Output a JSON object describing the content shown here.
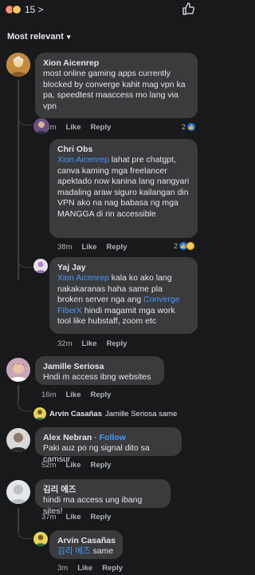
{
  "top": {
    "reaction_count": "15",
    "chevron": ">"
  },
  "sort": {
    "label": "Most relevant",
    "chevron": "⌄"
  },
  "comments": [
    {
      "name": "Xion Aicenrep",
      "text": "most online gaming apps currently blocked by converge kahit mag vpn ka pa, speedtest maaccess mo lang via vpn",
      "time": "42m",
      "like": "Like",
      "reply": "Reply",
      "reactions": "2"
    },
    {
      "name": "Chri Obs",
      "mention": "Xion Aicenrep",
      "text": " lahat pre chatgpt, canva kaming mga freelancer apektado now kanina lang nangyari madaling araw siguro kailangan din VPN ako na nag babasa ng mga MANGGA di rin accessible",
      "time": "38m",
      "like": "Like",
      "reply": "Reply",
      "reactions": "2"
    },
    {
      "name": "Yaj Jay",
      "mention": "Xion Aicenrep",
      "text_a": " kala ko ako lang nakakaranas haha same pla broken server nga ang ",
      "mention2": "Converge FiberX",
      "text_b": " hindi magamit mga work tool like hubstaff, zoom etc",
      "time": "32m",
      "like": "Like",
      "reply": "Reply"
    },
    {
      "name": "Jamille Seriosa",
      "text": "Hndi m access ibng websites",
      "time": "16m",
      "like": "Like",
      "reply": "Reply"
    },
    {
      "name": "Alex Nebran",
      "follow": "Follow",
      "dot": "·",
      "text": "Paki auz po ng signal dito sa camsur",
      "time": "52m",
      "like": "Like",
      "reply": "Reply"
    },
    {
      "name": "김리 에즈",
      "text": "hindi ma access ung ibang sites!",
      "time": "37m",
      "like": "Like",
      "reply": "Reply"
    },
    {
      "name": "Arvin Casañas",
      "mention": "김리 에즈",
      "text": " same",
      "time": "3m",
      "like": "Like",
      "reply": "Reply"
    }
  ],
  "reply_previews": [
    {
      "name": "Arvin Casañas",
      "text": "Jamille Seriosa same"
    }
  ],
  "colors": {
    "background": "#18191a",
    "bubble": "#3a3b3c",
    "mention": "#4599ff",
    "like_blue": "#1877f2"
  }
}
